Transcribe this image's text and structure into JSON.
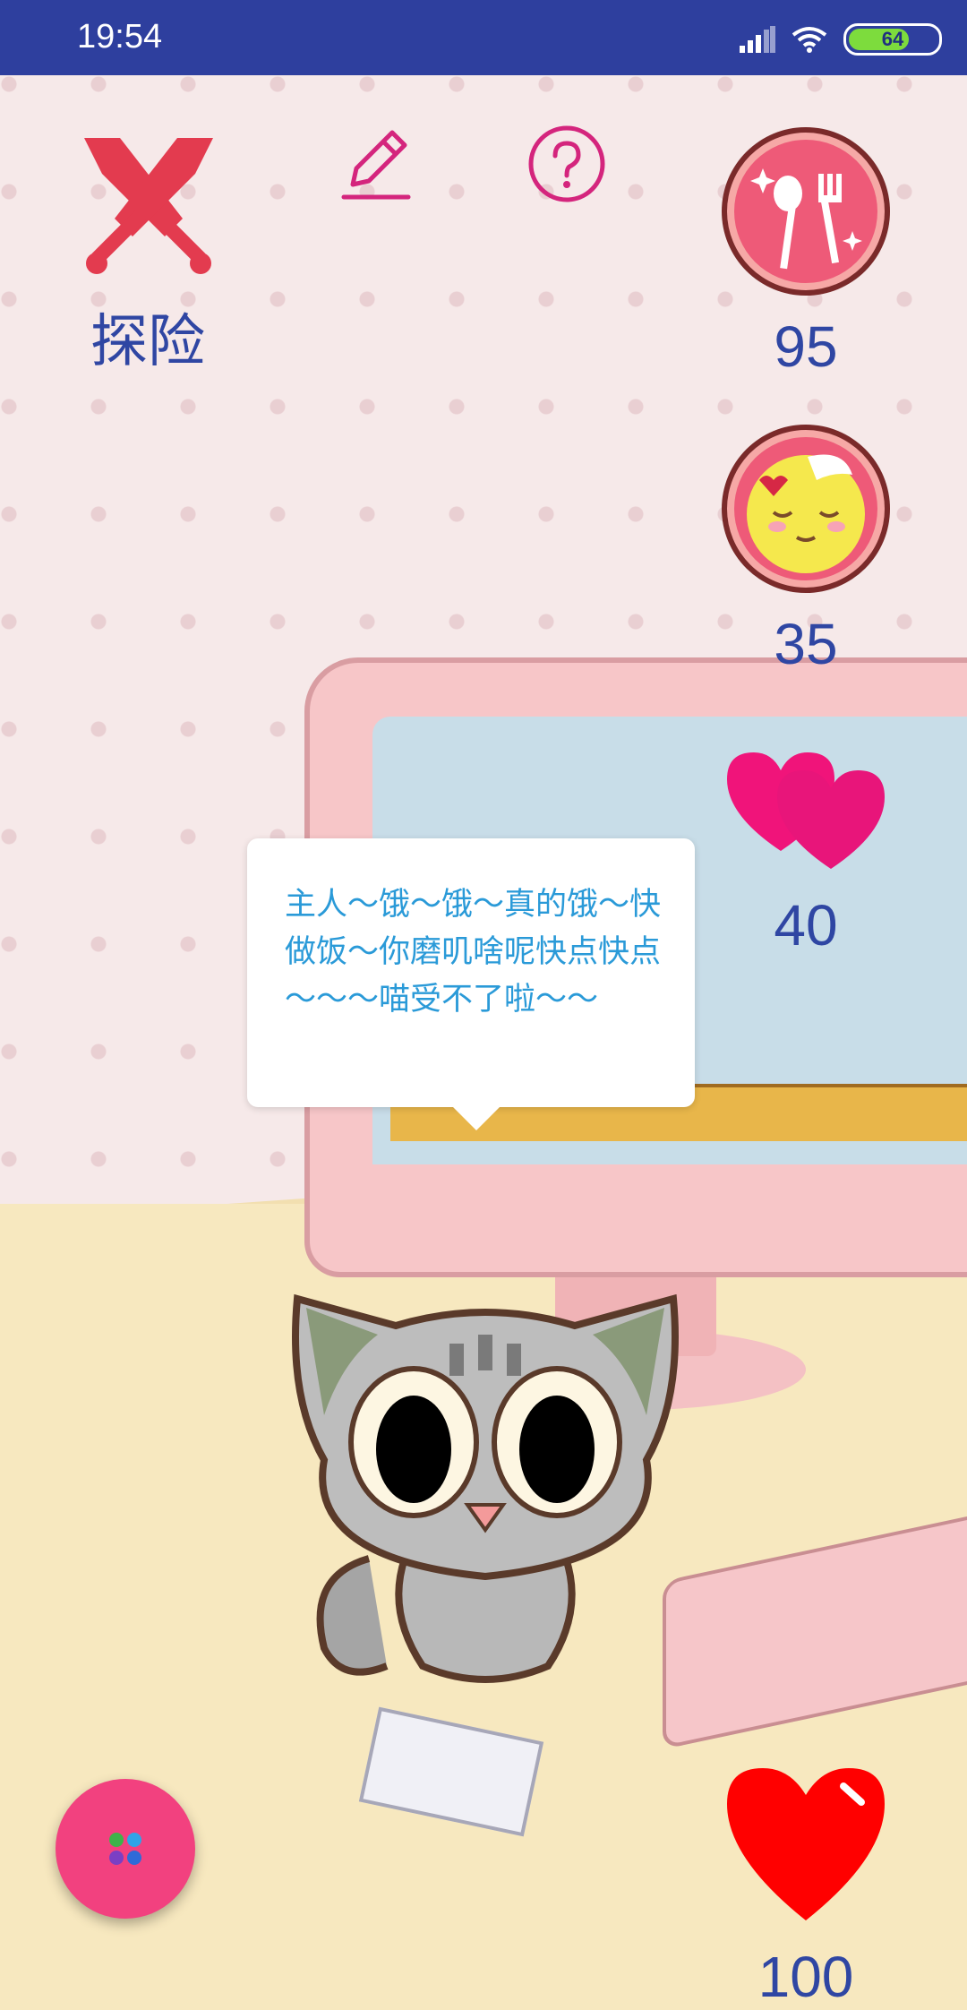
{
  "status_bar": {
    "time": "19:54",
    "battery": "64"
  },
  "top_bar": {
    "adventure_label": "探险"
  },
  "stats": {
    "food": "95",
    "mood": "35",
    "love": "40",
    "health": "100"
  },
  "speech": {
    "text": "主人～饿～饿～真的饿～快做饭～你磨叽啥呢快点快点～～～喵受不了啦～～"
  },
  "colors": {
    "status_bar": "#2e3f9e",
    "accent_blue": "#2f46a3",
    "speech_text": "#2a9ad8",
    "fab": "#f2417f",
    "heart_red": "#ff0000",
    "heart_pink": "#f0147a"
  },
  "icons": {
    "adventure": "crossed-swords-icon",
    "edit": "pencil-icon",
    "help": "question-icon",
    "food": "fork-spoon-icon",
    "mood": "face-icon",
    "love": "double-heart-icon",
    "health": "heart-icon",
    "menu": "dots-icon"
  }
}
